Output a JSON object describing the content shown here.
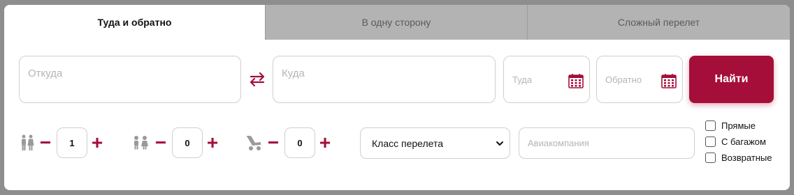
{
  "tabs": [
    {
      "label": "Туда и обратно",
      "active": true
    },
    {
      "label": "В одну сторону",
      "active": false
    },
    {
      "label": "Сложный перелет",
      "active": false
    }
  ],
  "route": {
    "from_placeholder": "Откуда",
    "to_placeholder": "Куда",
    "swap_icon": "swap-arrows-icon"
  },
  "dates": {
    "there_placeholder": "Туда",
    "back_placeholder": "Обратно",
    "calendar_icon": "calendar-icon"
  },
  "search_button": "Найти",
  "passengers": {
    "adults": {
      "icon": "adults-icon",
      "value": "1"
    },
    "children": {
      "icon": "children-icon",
      "value": "0"
    },
    "infants": {
      "icon": "infant-stroller-icon",
      "value": "0"
    },
    "minus": "−",
    "plus": "+"
  },
  "flight_class": {
    "selected": "Класс перелета"
  },
  "airline": {
    "placeholder": "Авиакомпания"
  },
  "filters": [
    {
      "label": "Прямые",
      "checked": false
    },
    {
      "label": "С багажом",
      "checked": false
    },
    {
      "label": "Возвратные",
      "checked": false
    }
  ],
  "colors": {
    "accent": "#a50e38",
    "tab_inactive": "#b3b3b3",
    "border": "#cfcfcf",
    "placeholder": "#b5b5b5",
    "icon_gray": "#9a9a9a"
  }
}
